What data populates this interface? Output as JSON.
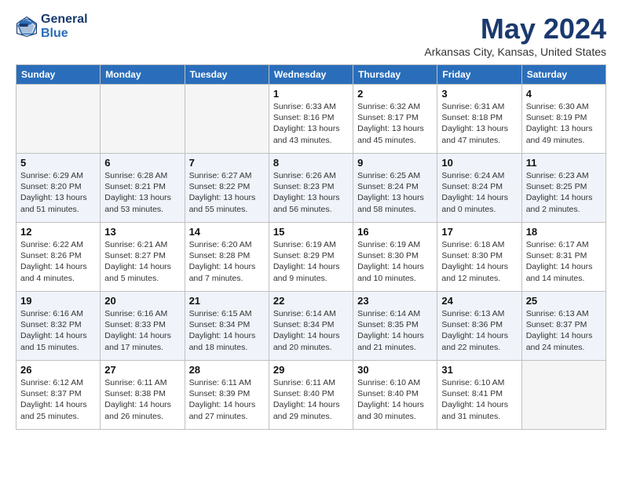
{
  "header": {
    "logo_line1": "General",
    "logo_line2": "Blue",
    "month": "May 2024",
    "location": "Arkansas City, Kansas, United States"
  },
  "weekdays": [
    "Sunday",
    "Monday",
    "Tuesday",
    "Wednesday",
    "Thursday",
    "Friday",
    "Saturday"
  ],
  "weeks": [
    [
      {
        "day": "",
        "info": ""
      },
      {
        "day": "",
        "info": ""
      },
      {
        "day": "",
        "info": ""
      },
      {
        "day": "1",
        "info": "Sunrise: 6:33 AM\nSunset: 8:16 PM\nDaylight: 13 hours\nand 43 minutes."
      },
      {
        "day": "2",
        "info": "Sunrise: 6:32 AM\nSunset: 8:17 PM\nDaylight: 13 hours\nand 45 minutes."
      },
      {
        "day": "3",
        "info": "Sunrise: 6:31 AM\nSunset: 8:18 PM\nDaylight: 13 hours\nand 47 minutes."
      },
      {
        "day": "4",
        "info": "Sunrise: 6:30 AM\nSunset: 8:19 PM\nDaylight: 13 hours\nand 49 minutes."
      }
    ],
    [
      {
        "day": "5",
        "info": "Sunrise: 6:29 AM\nSunset: 8:20 PM\nDaylight: 13 hours\nand 51 minutes."
      },
      {
        "day": "6",
        "info": "Sunrise: 6:28 AM\nSunset: 8:21 PM\nDaylight: 13 hours\nand 53 minutes."
      },
      {
        "day": "7",
        "info": "Sunrise: 6:27 AM\nSunset: 8:22 PM\nDaylight: 13 hours\nand 55 minutes."
      },
      {
        "day": "8",
        "info": "Sunrise: 6:26 AM\nSunset: 8:23 PM\nDaylight: 13 hours\nand 56 minutes."
      },
      {
        "day": "9",
        "info": "Sunrise: 6:25 AM\nSunset: 8:24 PM\nDaylight: 13 hours\nand 58 minutes."
      },
      {
        "day": "10",
        "info": "Sunrise: 6:24 AM\nSunset: 8:24 PM\nDaylight: 14 hours\nand 0 minutes."
      },
      {
        "day": "11",
        "info": "Sunrise: 6:23 AM\nSunset: 8:25 PM\nDaylight: 14 hours\nand 2 minutes."
      }
    ],
    [
      {
        "day": "12",
        "info": "Sunrise: 6:22 AM\nSunset: 8:26 PM\nDaylight: 14 hours\nand 4 minutes."
      },
      {
        "day": "13",
        "info": "Sunrise: 6:21 AM\nSunset: 8:27 PM\nDaylight: 14 hours\nand 5 minutes."
      },
      {
        "day": "14",
        "info": "Sunrise: 6:20 AM\nSunset: 8:28 PM\nDaylight: 14 hours\nand 7 minutes."
      },
      {
        "day": "15",
        "info": "Sunrise: 6:19 AM\nSunset: 8:29 PM\nDaylight: 14 hours\nand 9 minutes."
      },
      {
        "day": "16",
        "info": "Sunrise: 6:19 AM\nSunset: 8:30 PM\nDaylight: 14 hours\nand 10 minutes."
      },
      {
        "day": "17",
        "info": "Sunrise: 6:18 AM\nSunset: 8:30 PM\nDaylight: 14 hours\nand 12 minutes."
      },
      {
        "day": "18",
        "info": "Sunrise: 6:17 AM\nSunset: 8:31 PM\nDaylight: 14 hours\nand 14 minutes."
      }
    ],
    [
      {
        "day": "19",
        "info": "Sunrise: 6:16 AM\nSunset: 8:32 PM\nDaylight: 14 hours\nand 15 minutes."
      },
      {
        "day": "20",
        "info": "Sunrise: 6:16 AM\nSunset: 8:33 PM\nDaylight: 14 hours\nand 17 minutes."
      },
      {
        "day": "21",
        "info": "Sunrise: 6:15 AM\nSunset: 8:34 PM\nDaylight: 14 hours\nand 18 minutes."
      },
      {
        "day": "22",
        "info": "Sunrise: 6:14 AM\nSunset: 8:34 PM\nDaylight: 14 hours\nand 20 minutes."
      },
      {
        "day": "23",
        "info": "Sunrise: 6:14 AM\nSunset: 8:35 PM\nDaylight: 14 hours\nand 21 minutes."
      },
      {
        "day": "24",
        "info": "Sunrise: 6:13 AM\nSunset: 8:36 PM\nDaylight: 14 hours\nand 22 minutes."
      },
      {
        "day": "25",
        "info": "Sunrise: 6:13 AM\nSunset: 8:37 PM\nDaylight: 14 hours\nand 24 minutes."
      }
    ],
    [
      {
        "day": "26",
        "info": "Sunrise: 6:12 AM\nSunset: 8:37 PM\nDaylight: 14 hours\nand 25 minutes."
      },
      {
        "day": "27",
        "info": "Sunrise: 6:11 AM\nSunset: 8:38 PM\nDaylight: 14 hours\nand 26 minutes."
      },
      {
        "day": "28",
        "info": "Sunrise: 6:11 AM\nSunset: 8:39 PM\nDaylight: 14 hours\nand 27 minutes."
      },
      {
        "day": "29",
        "info": "Sunrise: 6:11 AM\nSunset: 8:40 PM\nDaylight: 14 hours\nand 29 minutes."
      },
      {
        "day": "30",
        "info": "Sunrise: 6:10 AM\nSunset: 8:40 PM\nDaylight: 14 hours\nand 30 minutes."
      },
      {
        "day": "31",
        "info": "Sunrise: 6:10 AM\nSunset: 8:41 PM\nDaylight: 14 hours\nand 31 minutes."
      },
      {
        "day": "",
        "info": ""
      }
    ]
  ]
}
